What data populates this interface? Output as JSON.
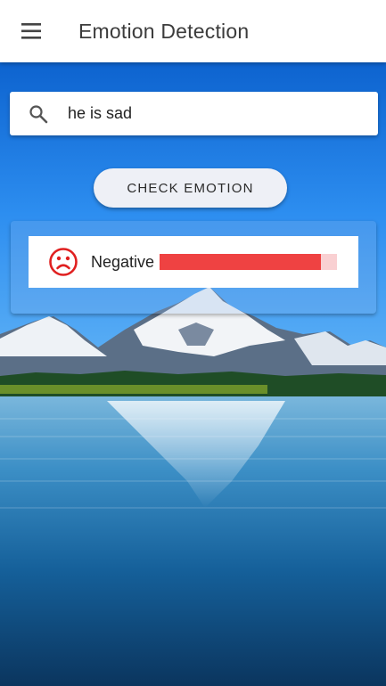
{
  "app": {
    "title": "Emotion Detection"
  },
  "icons": {
    "menu": "menu-icon",
    "search": "search-icon",
    "emotion": "sad-face-icon"
  },
  "search": {
    "value": "he is sad"
  },
  "actions": {
    "check_label": "CHECK EMOTION"
  },
  "result": {
    "label": "Negative",
    "score": 0.91,
    "bar_color": "#ef4242",
    "track_color": "#f9d0d2",
    "icon_color": "#e02020"
  }
}
